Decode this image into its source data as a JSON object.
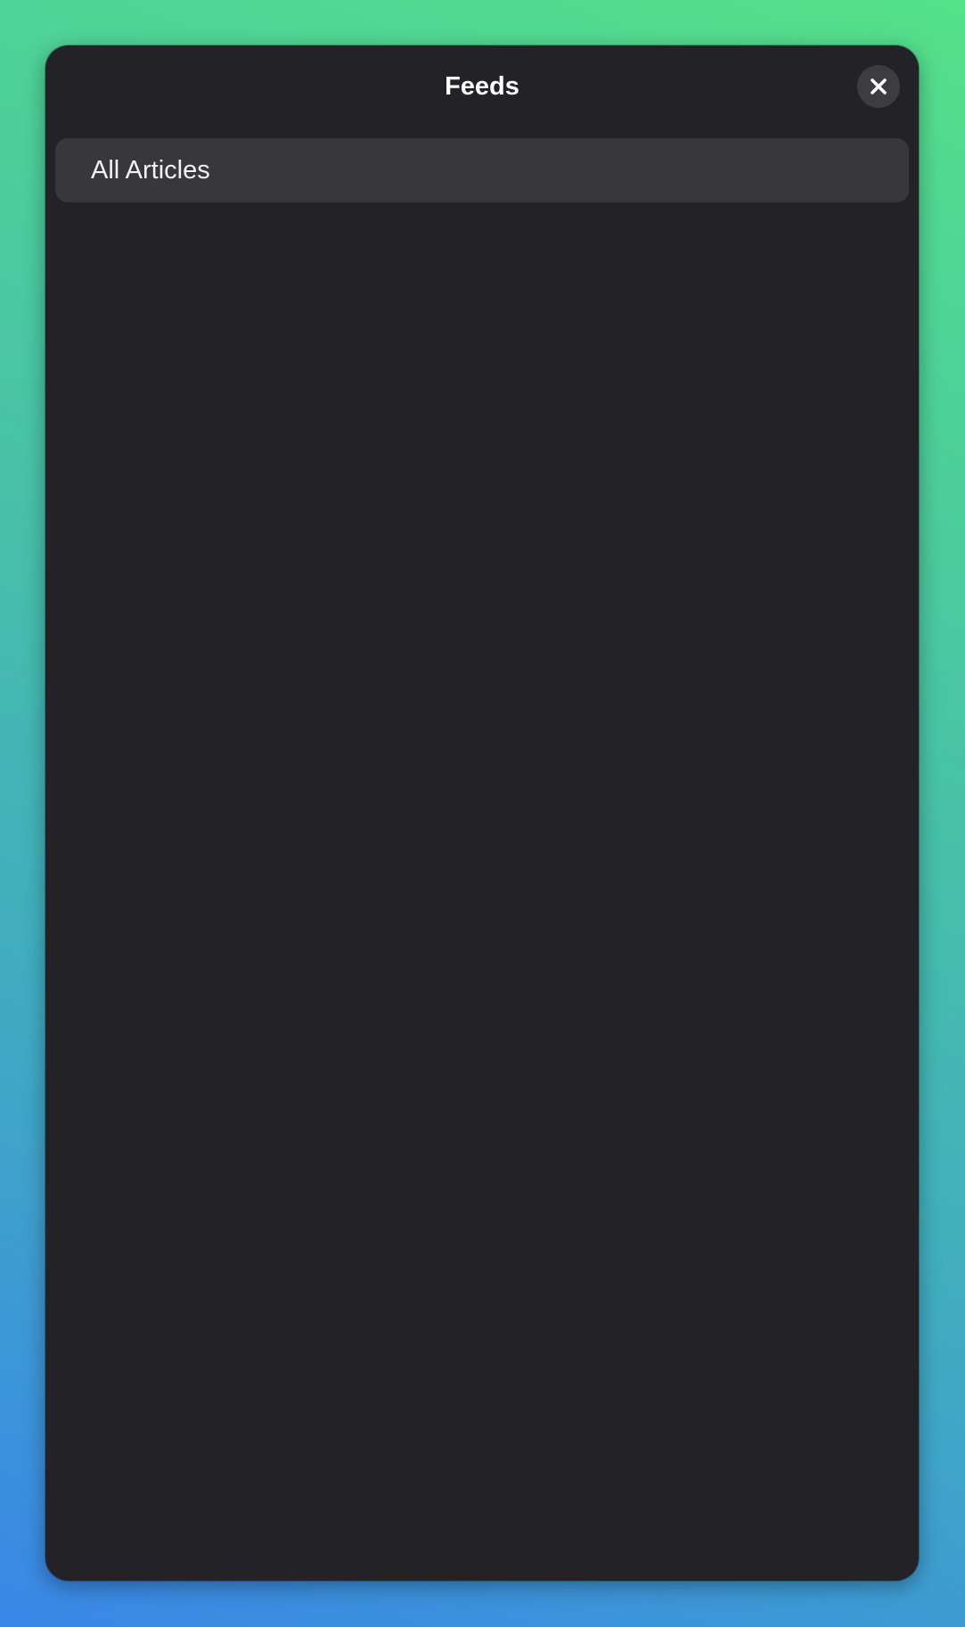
{
  "window": {
    "title": "Feeds"
  },
  "headerbar": {
    "close_icon": "close-icon"
  },
  "feeds": {
    "items": [
      {
        "label": "All Articles",
        "selected": true
      }
    ]
  },
  "colors": {
    "window_bg": "#232327",
    "row_bg": "#38383c",
    "close_button_bg": "#3d3d41",
    "text": "#ffffff"
  }
}
